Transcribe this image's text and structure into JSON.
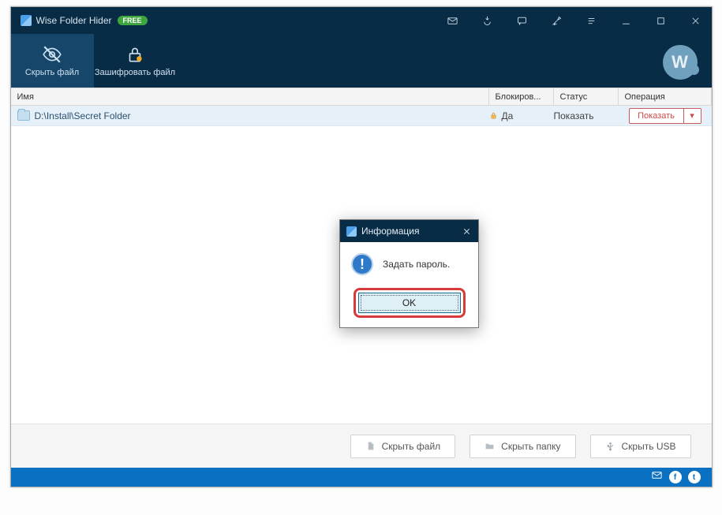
{
  "titlebar": {
    "app_name": "Wise Folder Hider",
    "badge": "FREE"
  },
  "toolbar": {
    "hide_file": "Скрыть файл",
    "encrypt_file": "Зашифровать файл",
    "brand_letter": "W"
  },
  "columns": {
    "name": "Имя",
    "lock": "Блокиров...",
    "status": "Статус",
    "operation": "Операция"
  },
  "rows": [
    {
      "path": "D:\\Install\\Secret Folder",
      "lock": "Да",
      "status": "Показать",
      "op": "Показать",
      "op_drop": "▾"
    }
  ],
  "footer": {
    "hide_file": "Скрыть файл",
    "hide_folder": "Скрыть папку",
    "hide_usb": "Скрыть USB"
  },
  "bottom_icons": {
    "fb": "f",
    "tw": "t"
  },
  "dialog": {
    "title": "Информация",
    "message": "Задать пароль.",
    "ok": "OK",
    "info_glyph": "!"
  }
}
